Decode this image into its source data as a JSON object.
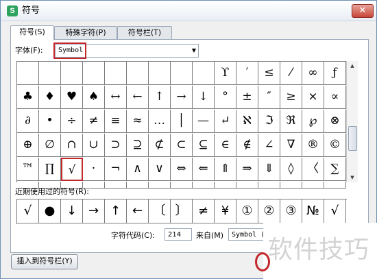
{
  "window": {
    "title": "符号",
    "app_icon_letter": "S",
    "close_label": "✕"
  },
  "tabs": [
    {
      "label": "符号(S)",
      "active": true
    },
    {
      "label": "特殊字符(P)",
      "active": false
    },
    {
      "label": "符号栏(T)",
      "active": false
    }
  ],
  "font": {
    "label": "字体(F):",
    "value": "Symbol",
    "arrow": "▼"
  },
  "symbol_rows": [
    [
      "",
      "",
      "",
      "",
      "",
      "",
      "",
      "",
      "",
      "ϒ",
      "′",
      "≤",
      "⁄",
      "∞",
      "ƒ"
    ],
    [
      "♣",
      "♦",
      "♥",
      "♠",
      "↔",
      "←",
      "↑",
      "→",
      "↓",
      "°",
      "±",
      "″",
      "≥",
      "×",
      "∝"
    ],
    [
      "∂",
      "•",
      "÷",
      "≠",
      "≡",
      "≈",
      "…",
      "│",
      "—",
      "↵",
      "ℵ",
      "ℑ",
      "ℜ",
      "℘",
      "⊗"
    ],
    [
      "⊕",
      "∅",
      "∩",
      "∪",
      "⊃",
      "⊇",
      "⊄",
      "⊂",
      "⊆",
      "∈",
      "∉",
      "∠",
      "∇",
      "®",
      "©"
    ],
    [
      "™",
      "∏",
      "√",
      "·",
      "¬",
      "∧",
      "∨",
      "⇔",
      "⇐",
      "⇑",
      "⇒",
      "⇓",
      "◊",
      "〈",
      "∑"
    ]
  ],
  "selected_symbol": "√",
  "scrollbar": {
    "up": "▲",
    "down": "▼"
  },
  "recent": {
    "label": "近期使用过的符号(R):",
    "items": [
      "√",
      "●",
      "↓",
      "→",
      "↑",
      "←",
      "〔",
      "〕",
      "≠",
      "¥",
      "①",
      "②",
      "③",
      "№",
      "√"
    ]
  },
  "char_code": {
    "label": "字符代码(C):",
    "value": "214"
  },
  "from": {
    "label": "来自(M)",
    "value": "Symbol (+"
  },
  "insert_to_bar_button": "插入到符号栏(Y)",
  "watermark": "软件技巧"
}
